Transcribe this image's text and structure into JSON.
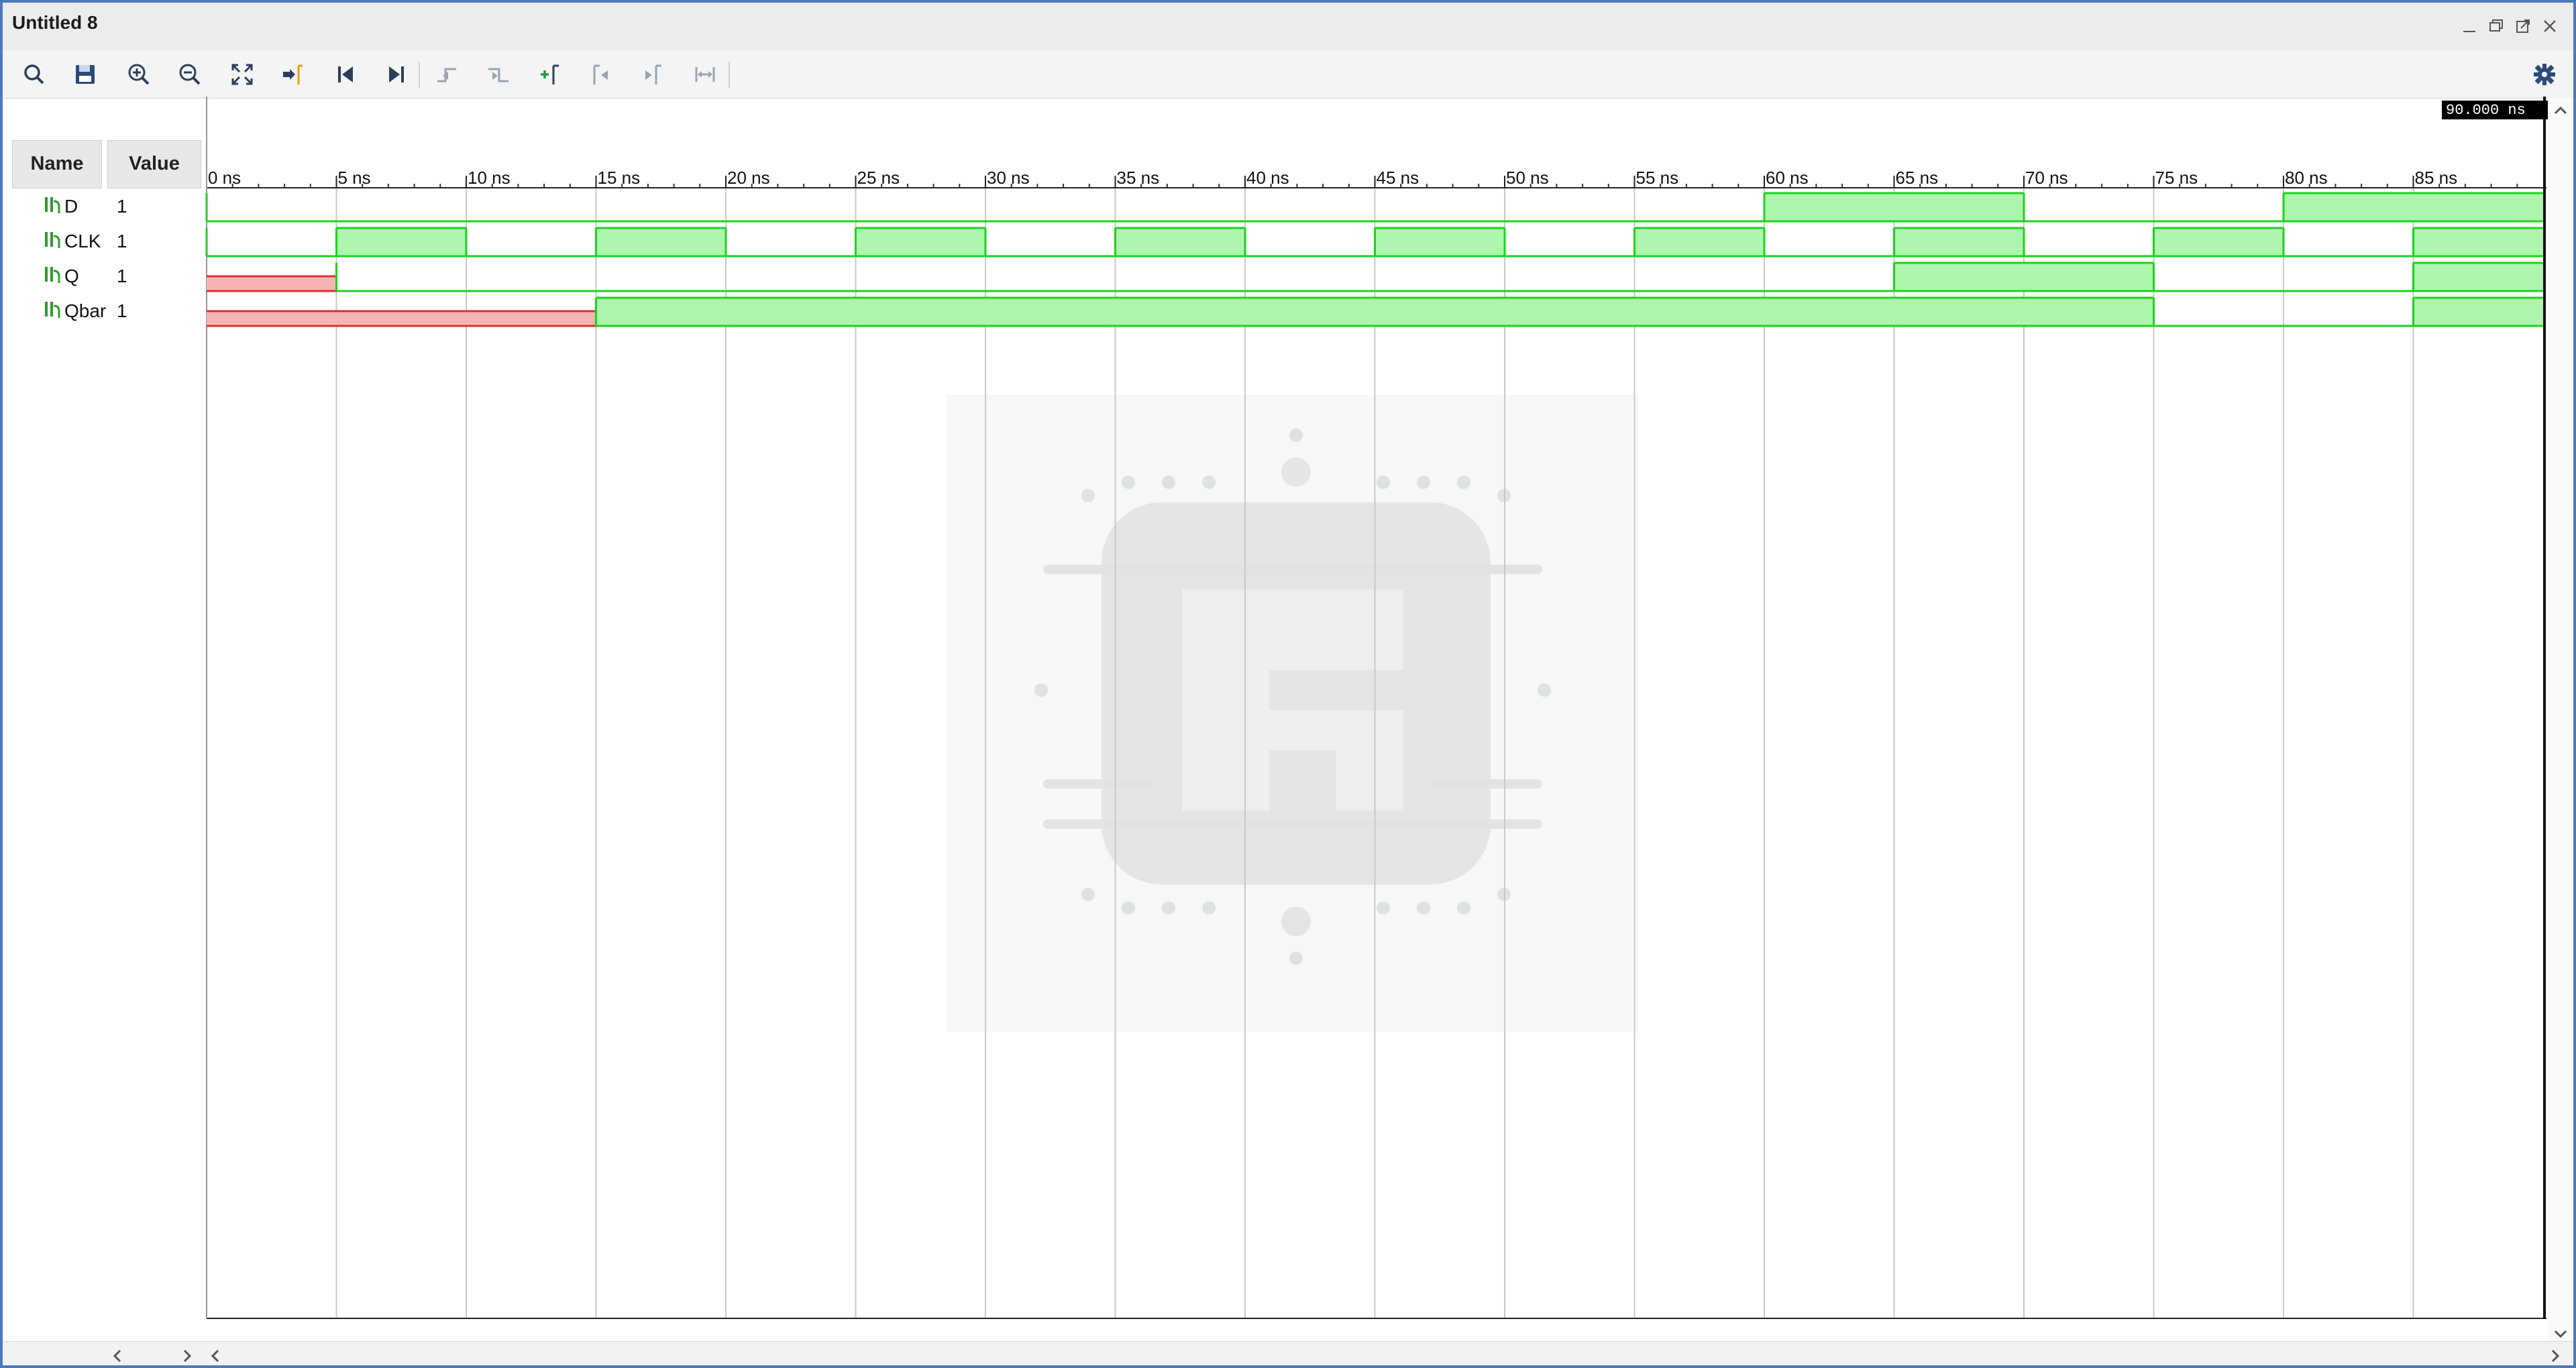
{
  "window": {
    "title": "Untitled 8"
  },
  "toolbar": {
    "icons": [
      "search-icon",
      "save-icon",
      "zoom-in-icon",
      "zoom-out-icon",
      "zoom-fit-icon",
      "go-to-cursor-icon",
      "go-to-time-zero-icon",
      "go-to-last-time-icon",
      "previous-transition-icon",
      "next-transition-icon",
      "add-marker-icon",
      "previous-marker-icon",
      "next-marker-icon",
      "swap-cursors-icon",
      "settings-icon"
    ]
  },
  "signal_panel": {
    "name_header": "Name",
    "value_header": "Value",
    "signals": [
      {
        "name": "D",
        "value": "1"
      },
      {
        "name": "CLK",
        "value": "1"
      },
      {
        "name": "Q",
        "value": "1"
      },
      {
        "name": "Qbar",
        "value": "1"
      }
    ]
  },
  "timeline": {
    "cursor_label": "90.000 ns",
    "ticks": [
      "0 ns",
      "5 ns",
      "10 ns",
      "15 ns",
      "20 ns",
      "25 ns",
      "30 ns",
      "35 ns",
      "40 ns",
      "45 ns",
      "50 ns",
      "55 ns",
      "60 ns",
      "65 ns",
      "70 ns",
      "75 ns",
      "80 ns",
      "85 ns"
    ]
  },
  "colors": {
    "high_fill": "#aef5ae",
    "high_stroke": "#1ed21e",
    "unknown_fill": "#f7b4b4",
    "unknown_stroke": "#d83030",
    "accent": "#4f79b9"
  }
}
